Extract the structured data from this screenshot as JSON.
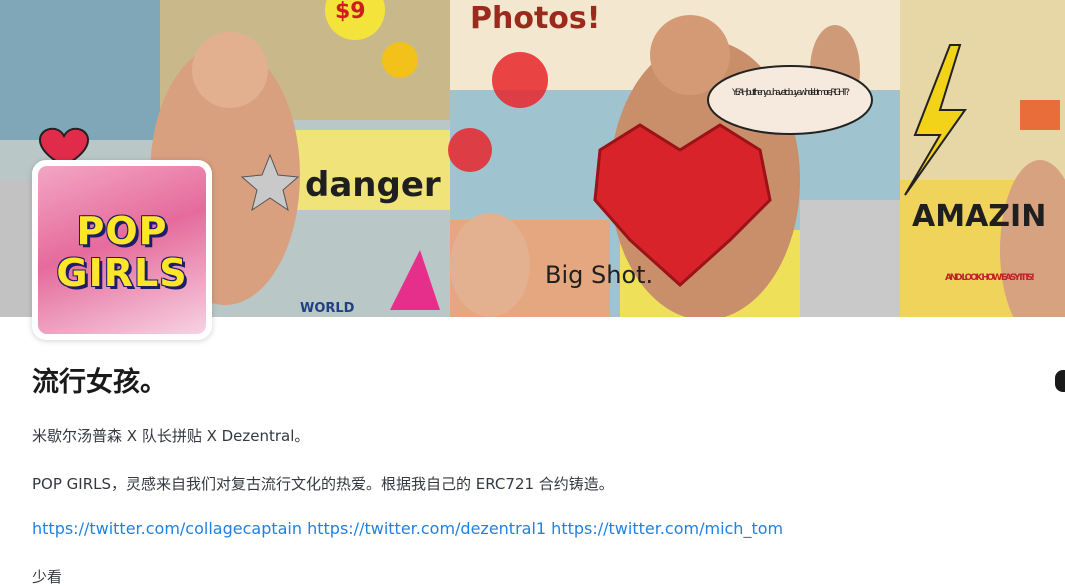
{
  "collection": {
    "avatar_text": [
      "POP",
      "GIRLS"
    ],
    "title": "流行女孩。",
    "description_line1": "米歇尔汤普森 X 队长拼贴 X Dezentral。",
    "description_line2": "POP GIRLS，灵感来自我们对复古流行文化的热爱。根据我自己的 ERC721 合约铸造。",
    "links": [
      "https://twitter.com/collagecaptain",
      "https://twitter.com/dezentral1",
      "https://twitter.com/mich_tom"
    ],
    "description_line3": "少看"
  },
  "banner": {
    "texts": [
      "Photos!",
      "danger",
      "Big Shot.",
      "AMAZIN",
      "YEAH, but then you have to buy a whole lot more, RIGHT?",
      "AND LOOK HOW EASY IT IS!",
      "WORLD",
      "$9"
    ]
  },
  "colors": {
    "link": "#2081e2",
    "heart": "#d8232a",
    "avatar_yellow": "#ffe629"
  }
}
